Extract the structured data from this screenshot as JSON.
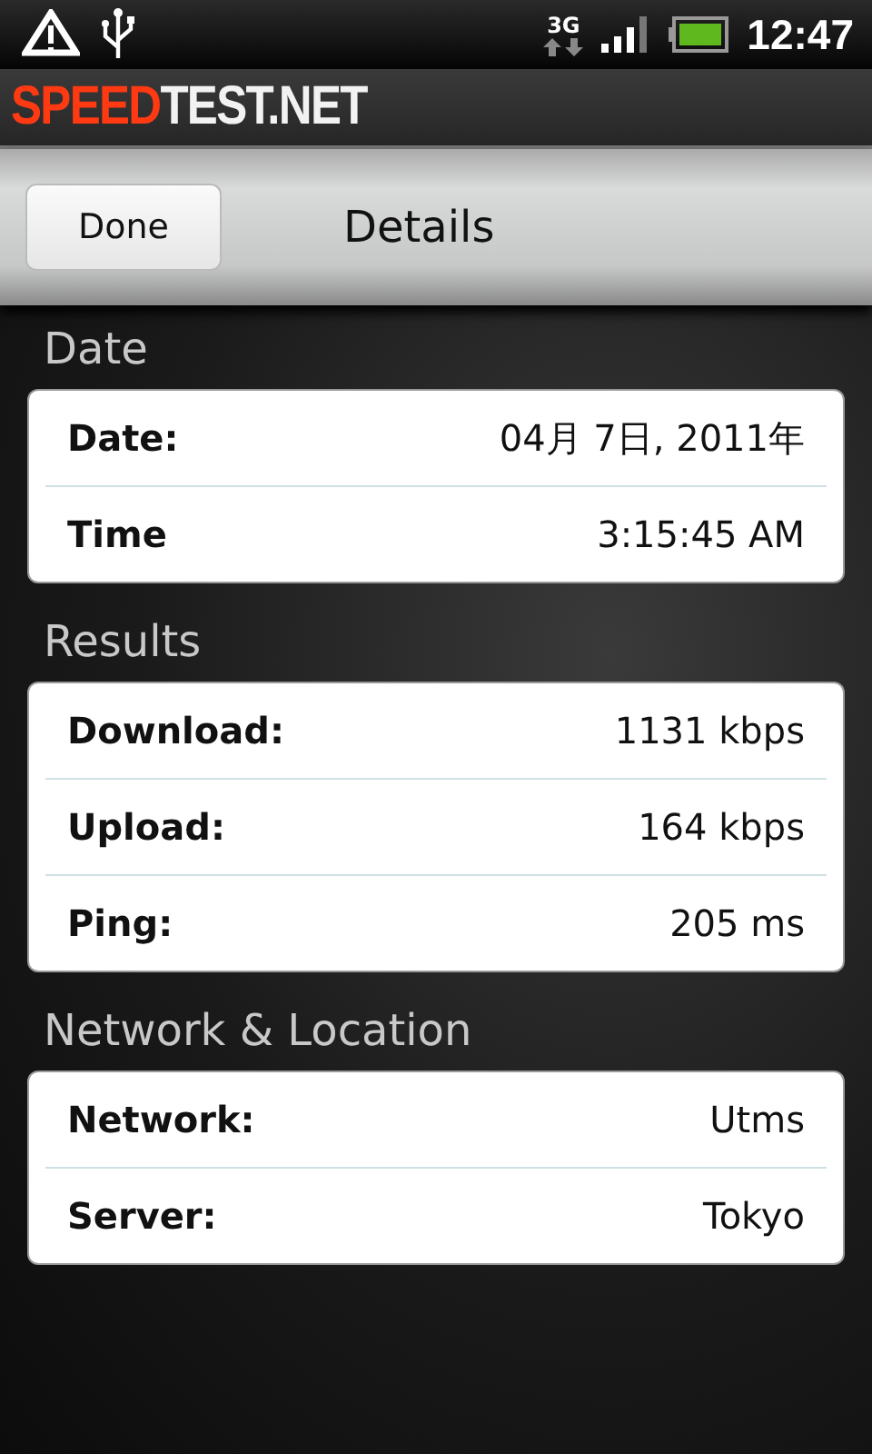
{
  "status_bar": {
    "network_type": "3G",
    "time": "12:47"
  },
  "brand": {
    "accent": "SPEED",
    "rest": "TEST.NET"
  },
  "header": {
    "button": "Done",
    "title": "Details"
  },
  "sections": [
    {
      "title": "Date",
      "rows": [
        {
          "label": "Date:",
          "value": "04月 7日, 2011年"
        },
        {
          "label": "Time",
          "value": "3:15:45 AM"
        }
      ]
    },
    {
      "title": "Results",
      "rows": [
        {
          "label": "Download:",
          "value": "1131 kbps"
        },
        {
          "label": "Upload:",
          "value": "164 kbps"
        },
        {
          "label": "Ping:",
          "value": "205 ms"
        }
      ]
    },
    {
      "title": "Network & Location",
      "rows": [
        {
          "label": "Network:",
          "value": "Utms"
        },
        {
          "label": "Server:",
          "value": "Tokyo"
        }
      ]
    }
  ]
}
